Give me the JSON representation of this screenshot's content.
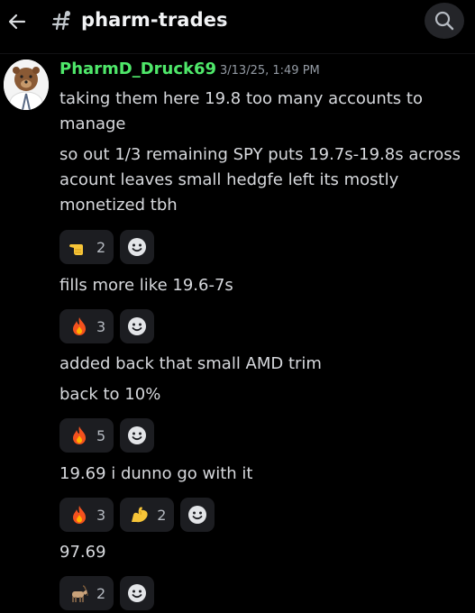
{
  "header": {
    "channel_name": "pharm-trades",
    "chevron": "›",
    "back_icon": "arrow-left-icon",
    "search_icon": "search-icon"
  },
  "message_group": {
    "author": "PharmD_Druck69",
    "timestamp": "3/13/25, 1:49 PM",
    "author_color": "#4fe86a",
    "avatar": "bear-in-lab-coat-avatar"
  },
  "messages": [
    {
      "text_lines": [
        "taking them here 19.8 too many accounts to",
        "manage"
      ]
    },
    {
      "text_lines": [
        "so out 1/3 remaining SPY puts 19.7s-19.8s across",
        "acount leaves small hedgfe left its mostly",
        "monetized tbh"
      ],
      "reactions": [
        {
          "emoji": "pointing-hand-emoji",
          "count": "2"
        }
      ]
    },
    {
      "text_lines": [
        "fills more like 19.6-7s"
      ],
      "reactions": [
        {
          "emoji": "fire-emoji",
          "count": "3"
        }
      ]
    },
    {
      "text_lines": [
        "added back that small AMD trim"
      ]
    },
    {
      "text_lines": [
        "back to 10%"
      ],
      "reactions": [
        {
          "emoji": "fire-emoji",
          "count": "5"
        }
      ]
    },
    {
      "text_lines": [
        "19.69 i dunno go with it"
      ],
      "reactions": [
        {
          "emoji": "fire-emoji",
          "count": "3"
        },
        {
          "emoji": "flexed-biceps-emoji",
          "count": "2"
        }
      ]
    },
    {
      "text_lines": [
        "97.69"
      ],
      "reactions": [
        {
          "emoji": "goat-emoji",
          "count": "2"
        }
      ]
    }
  ]
}
